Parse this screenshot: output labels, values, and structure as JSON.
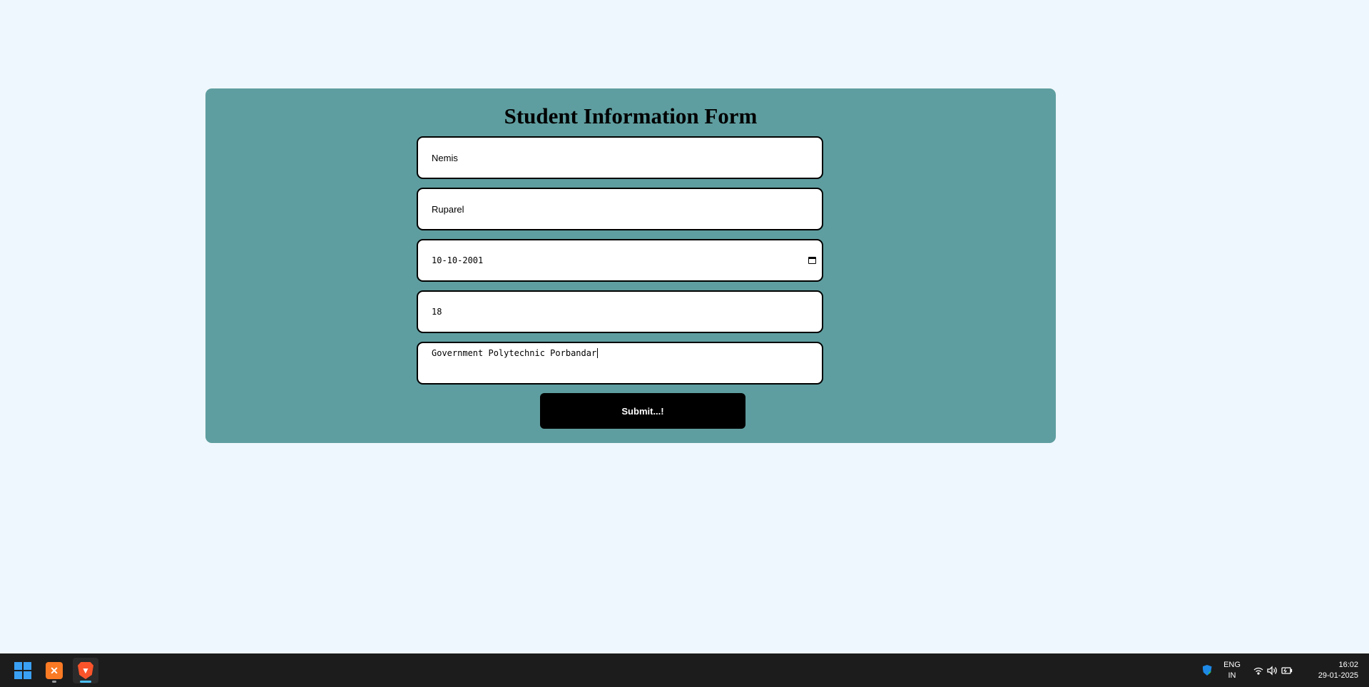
{
  "form": {
    "title": "Student Information Form",
    "first_name": "Nemis",
    "last_name": "Ruparel",
    "dob": "10-10-2001",
    "age": "18",
    "college": "Government Polytechnic Porbandar",
    "submit_label": "Submit...!"
  },
  "taskbar": {
    "apps": [
      {
        "name": "start-button",
        "icon": "windows-logo-icon"
      },
      {
        "name": "xampp",
        "icon": "xampp-icon"
      },
      {
        "name": "brave",
        "icon": "brave-icon",
        "active": true
      }
    ],
    "tray": {
      "lang_line1": "ENG",
      "lang_line2": "IN",
      "time": "16:02",
      "date": "29-01-2025"
    }
  },
  "colors": {
    "page_bg": "#eff7fe",
    "card_bg": "#5f9ea0",
    "button_bg": "#000000",
    "taskbar_bg": "#1c1c1c"
  }
}
